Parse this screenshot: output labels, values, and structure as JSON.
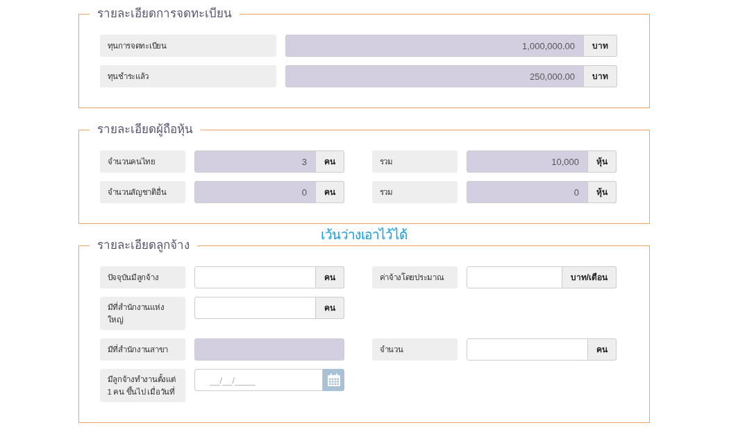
{
  "blocks": [
    {
      "kind": "fieldset",
      "legend": "รายละเอียดการจดทะเบียน",
      "rows": [
        {
          "fields": [
            {
              "label": "ทุนการจดทะเบียน",
              "kind": "number",
              "readonly": true,
              "value": "1,000,000.00",
              "unit": "บาท"
            }
          ]
        },
        {
          "fields": [
            {
              "label": "ทุนชำระแล้ว",
              "kind": "number",
              "readonly": true,
              "value": "250,000.00",
              "unit": "บาท"
            }
          ]
        }
      ]
    },
    {
      "kind": "fieldset",
      "legend": "รายละเอียดผู้ถือหุ้น",
      "rows": [
        {
          "fields": [
            {
              "label": "จำนวนคนไทย",
              "kind": "number",
              "readonly": true,
              "value": "3",
              "unit": "คน"
            },
            {
              "label": "รวม",
              "kind": "number",
              "readonly": true,
              "value": "10,000",
              "unit": "หุ้น"
            }
          ]
        },
        {
          "fields": [
            {
              "label": "จำนวนสัญชาติอื่น",
              "kind": "number",
              "readonly": true,
              "value": "0",
              "unit": "คน"
            },
            {
              "label": "รวม",
              "kind": "number",
              "readonly": true,
              "value": "0",
              "unit": "หุ้น"
            }
          ]
        }
      ]
    },
    {
      "kind": "note",
      "text": "เว้นว่างเอาไว้ได้"
    },
    {
      "kind": "fieldset",
      "legend": "รายละเอียดลูกจ้าง",
      "rows": [
        {
          "fields": [
            {
              "label": "ปัจจุบันมีลูกจ้าง",
              "kind": "number",
              "readonly": false,
              "unit": "คน"
            },
            {
              "label": "ค่าจ้างโดยประมาณ",
              "kind": "number",
              "readonly": false,
              "unit": "บาท/เดือน"
            }
          ]
        },
        {
          "fields": [
            {
              "label": "มีที่สำนักงานแห่งใหญ่",
              "kind": "number",
              "readonly": false,
              "unit": "คน"
            }
          ]
        },
        {
          "fields": [
            {
              "label": "มีที่สำนักงานสาขา",
              "kind": "number",
              "readonly": true
            },
            {
              "label": "จำนวน",
              "kind": "number",
              "readonly": false,
              "unit": "คน"
            }
          ]
        },
        {
          "fields": [
            {
              "label": "มีลูกจ้างทำงานตั้งแต่ 1 คน ขึ้นไป เมื่อวันที่",
              "kind": "date",
              "readonly": false,
              "placeholder": "__/__/____"
            }
          ]
        }
      ]
    }
  ]
}
